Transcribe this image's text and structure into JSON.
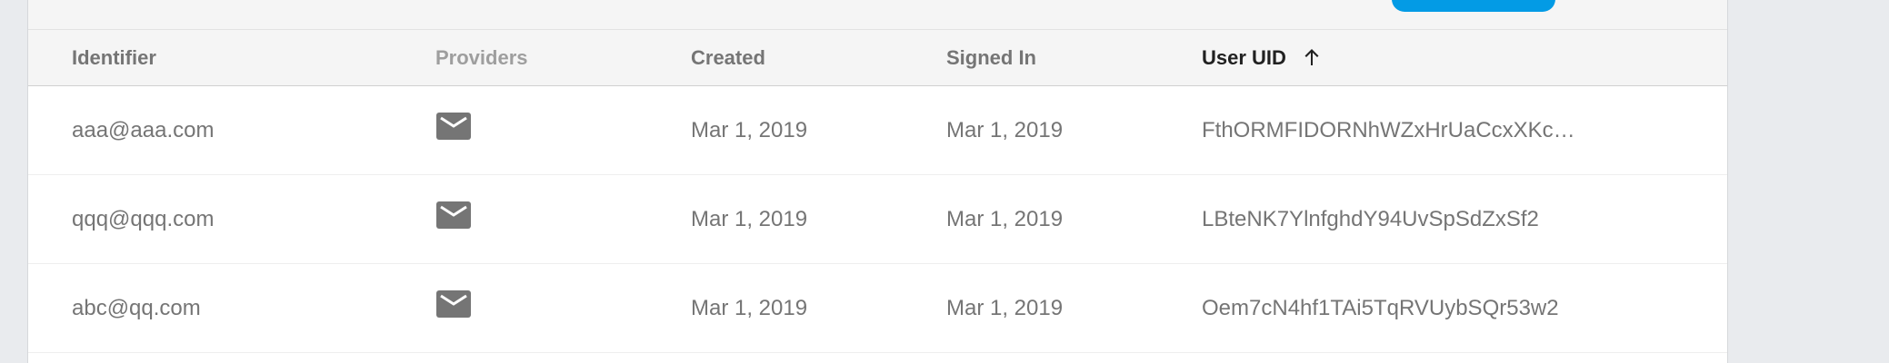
{
  "table": {
    "columns": {
      "identifier": "Identifier",
      "providers": "Providers",
      "created": "Created",
      "signed_in": "Signed In",
      "user_uid": "User UID"
    },
    "sort": {
      "column": "User UID",
      "direction": "ascending",
      "icon": "arrow-up-icon"
    },
    "rows": [
      {
        "identifier": "aaa@aaa.com",
        "provider_icon": "email-icon",
        "created": "Mar 1, 2019",
        "signed_in": "Mar 1, 2019",
        "user_uid": "FthORMFIDORNhWZxHrUaCcxXKc…"
      },
      {
        "identifier": "qqq@qqq.com",
        "provider_icon": "email-icon",
        "created": "Mar 1, 2019",
        "signed_in": "Mar 1, 2019",
        "user_uid": "LBteNK7YlnfghdY94UvSpSdZxSf2"
      },
      {
        "identifier": "abc@qq.com",
        "provider_icon": "email-icon",
        "created": "Mar 1, 2019",
        "signed_in": "Mar 1, 2019",
        "user_uid": "Oem7cN4hf1TAi5TqRVUybSQr53w2"
      }
    ]
  },
  "colors": {
    "accent": "#039be5",
    "header_bg": "#f5f5f5",
    "text_primary": "#212121",
    "text_secondary": "#757575",
    "page_bg": "#e9ebee"
  }
}
